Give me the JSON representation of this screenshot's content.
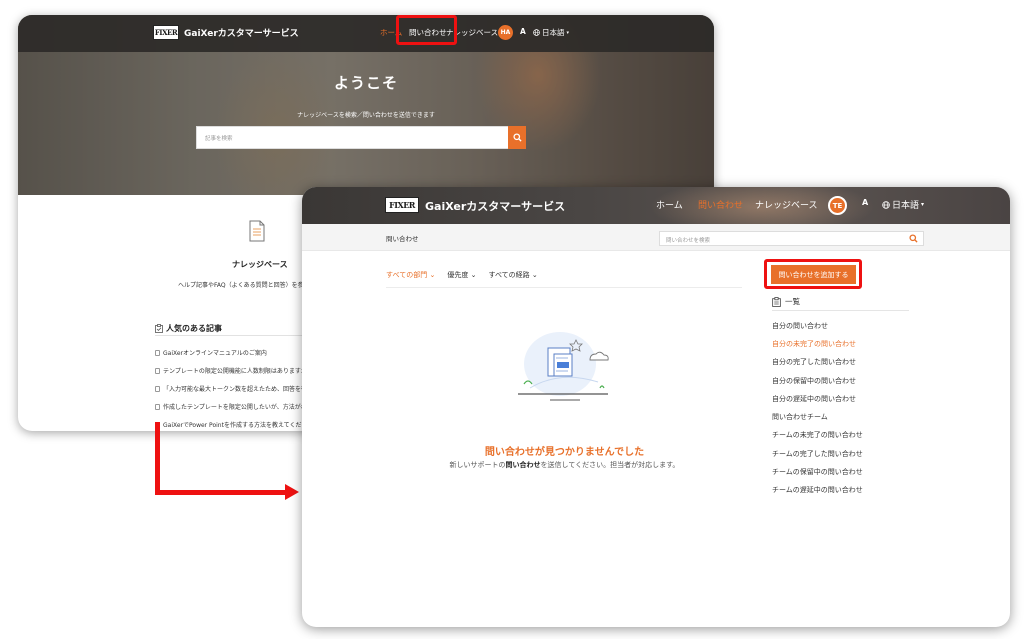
{
  "back_window": {
    "logo_text": "FIXER",
    "brand": "GaiXerカスタマーサービス",
    "nav": {
      "home": "ホーム",
      "inquiries": "問い合わせ",
      "knowledge": "ナレッジベース"
    },
    "avatar": "HA",
    "font_size_icon": "A",
    "language": "日本語",
    "welcome": "ようこそ",
    "subtitle": "ナレッジベースを検索／問い合わせを送信できます",
    "search_placeholder": "記事を検索",
    "knowledge_base": {
      "title": "ナレッジベース",
      "description": "ヘルプ記事やFAQ（よくある質問と回答）を参"
    },
    "popular": {
      "title": "人気のある記事",
      "articles": [
        "GaiXerオンラインマニュアルのご案内",
        "テンプレートの限定公開機能に人数制限はありますか",
        "「入力可能な最大トークン数を超えたため、回答を行",
        "作成したテンプレートを限定公開したいが、方法がわ",
        "GaiXerでPower Pointを作成する方法を教えてください"
      ]
    }
  },
  "front_window": {
    "logo_text": "FIXER",
    "brand": "GaiXerカスタマーサービス",
    "nav": {
      "home": "ホーム",
      "inquiries": "問い合わせ",
      "knowledge": "ナレッジベース"
    },
    "avatar": "TE",
    "font_size_icon": "A",
    "language": "日本語",
    "breadcrumb": "問い合わせ",
    "search_placeholder": "問い合わせを検索",
    "filters": [
      "すべての部門",
      "優先度",
      "すべての経路"
    ],
    "empty_title": "問い合わせが見つかりませんでした",
    "empty_desc_before": "新しいサポートの",
    "empty_desc_bold": "問い合わせ",
    "empty_desc_after": "を送信してください。担当者が対応します。",
    "add_button": "問い合わせを追加する",
    "list_heading": "一覧",
    "list_items": [
      "自分の問い合わせ",
      "自分の未完了の問い合わせ",
      "自分の完了した問い合わせ",
      "自分の保留中の問い合わせ",
      "自分の遅延中の問い合わせ",
      "問い合わせチーム",
      "チームの未完了の問い合わせ",
      "チームの完了した問い合わせ",
      "チームの保留中の問い合わせ",
      "チームの遅延中の問い合わせ"
    ],
    "active_list_index": 1
  },
  "colors": {
    "accent": "#e8702a",
    "highlight": "#ee1111",
    "avatar_back": "#e8702a",
    "avatar_front": "#e8702a"
  }
}
